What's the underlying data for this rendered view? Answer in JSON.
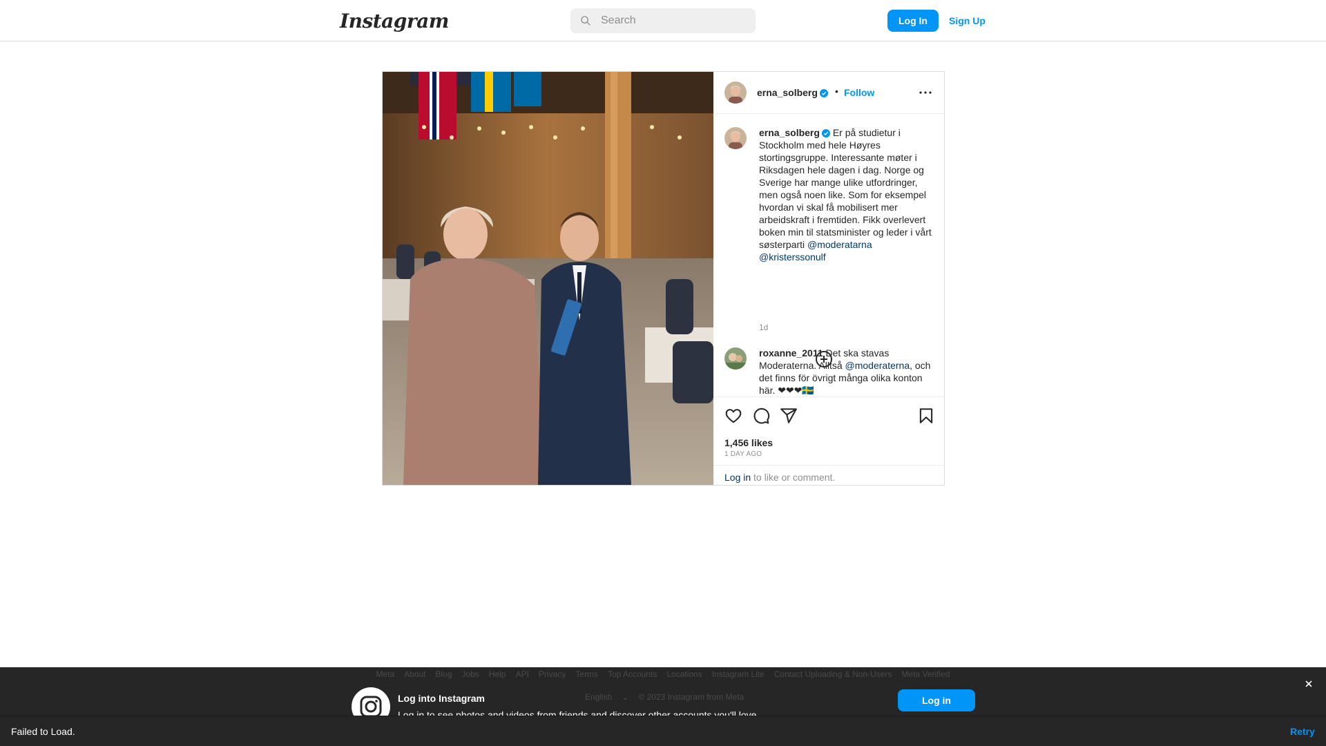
{
  "header": {
    "logo_text": "Instagram",
    "search_placeholder": "Search",
    "login_label": "Log In",
    "signup_label": "Sign Up"
  },
  "post": {
    "author": "erna_solberg",
    "verified": true,
    "follow_label": "Follow",
    "bullet": "•",
    "caption": {
      "author": "erna_solberg",
      "text": " Er på studietur i Stockholm med hele Høyres stortingsgruppe. Interessante møter i Riksdagen hele dagen i dag. Norge og Sverige har mange ulike utfordringer, men også noen like. Som for eksempel hvordan vi skal få mobilisert mer arbeidskraft i fremtiden. Fikk overlevert boken min til statsminister og leder i vårt søsterparti ",
      "mention1": "@moderatarna",
      "mention2": "@kristerssonulf",
      "time": "1d"
    },
    "comments": [
      {
        "author": "roxanne_2011",
        "text_before": " Det ska stavas Moderaterna. Alltså ",
        "mention": "@moderaterna",
        "text_after": ", och det finns för övrigt många olika konton här. ❤❤❤🇸🇪"
      }
    ],
    "likes": "1,456 likes",
    "posted_ago": "1 DAY AGO",
    "login_link": "Log in",
    "login_suffix": " to like or comment."
  },
  "footer": {
    "links": [
      "Meta",
      "About",
      "Blog",
      "Jobs",
      "Help",
      "API",
      "Privacy",
      "Terms",
      "Top Accounts",
      "Locations",
      "Instagram Lite",
      "Contact Uploading & Non-Users",
      "Meta Verified"
    ],
    "language": "English",
    "copyright": "© 2023 Instagram from Meta"
  },
  "login_banner": {
    "title": "Log into Instagram",
    "subtitle": "Log in to see photos and videos from friends and discover other accounts you'll love.",
    "button": "Log in"
  },
  "toast": {
    "message": "Failed to Load.",
    "action": "Retry"
  },
  "colors": {
    "accent": "#0095f6",
    "mention": "#00376b",
    "verified": "#0095f6",
    "dark_bar": "#262626"
  }
}
